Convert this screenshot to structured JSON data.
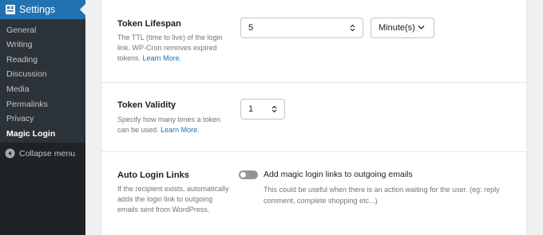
{
  "sidebar": {
    "menu_title": "Settings",
    "items": [
      {
        "label": "General"
      },
      {
        "label": "Writing"
      },
      {
        "label": "Reading"
      },
      {
        "label": "Discussion"
      },
      {
        "label": "Media"
      },
      {
        "label": "Permalinks"
      },
      {
        "label": "Privacy"
      },
      {
        "label": "Magic Login",
        "current": true
      }
    ],
    "collapse_label": "Collapse menu"
  },
  "settings": {
    "token_lifespan": {
      "title": "Token Lifespan",
      "description": "The TTL (time to live) of the login link. WP-Cron removes expired tokens.",
      "link": "Learn More.",
      "value": "5",
      "unit": "Minute(s)"
    },
    "token_validity": {
      "title": "Token Validity",
      "description": "Specify how many times a token can be used.",
      "link": "Learn More.",
      "value": "1"
    },
    "auto_login_links": {
      "title": "Auto Login Links",
      "description": "If the recipient exists, automatically adds the login link to outgoing emails sent from WordPress.",
      "toggle_label": "Add magic login links to outgoing emails",
      "toggle_on": false,
      "help": "This could be useful when there is an action waiting for the user. (eg: reply comment, complete shopping etc...)"
    }
  },
  "colors": {
    "sidebar_bg": "#1d2327",
    "submenu_bg": "#2c3338",
    "accent": "#2271b1",
    "link": "#2271b1"
  }
}
